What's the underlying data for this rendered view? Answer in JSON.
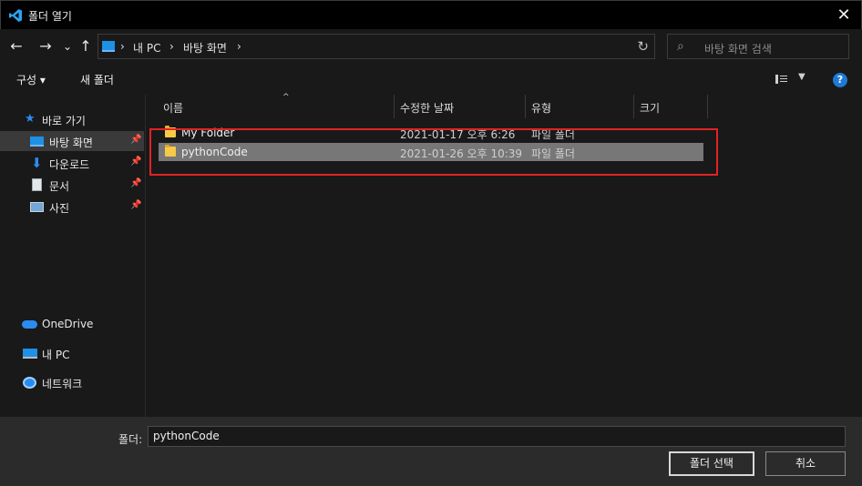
{
  "titlebar": {
    "title": "폴더 열기",
    "app_icon": "vscode-icon",
    "close_label": "✕"
  },
  "navbar": {
    "back_glyph": "←",
    "forward_glyph": "→",
    "recent_glyph": "⌄",
    "up_glyph": "↑",
    "breadcrumb": [
      "내 PC",
      "바탕 화면"
    ],
    "separator": "›",
    "refresh_glyph": "↻",
    "search_placeholder": "바탕 화면 검색"
  },
  "toolbar": {
    "organize": "구성 ▾",
    "new_folder": "새 폴더",
    "help": "?"
  },
  "sidebar": {
    "items": [
      {
        "label": "바로 가기",
        "icon": "star-icon"
      },
      {
        "label": "바탕 화면",
        "icon": "desktop-icon",
        "pinned": true,
        "selected": true
      },
      {
        "label": "다운로드",
        "icon": "download-icon",
        "pinned": true
      },
      {
        "label": "문서",
        "icon": "document-icon",
        "pinned": true
      },
      {
        "label": "사진",
        "icon": "picture-icon",
        "pinned": true
      },
      {
        "label": "OneDrive",
        "icon": "onedrive-icon"
      },
      {
        "label": "내 PC",
        "icon": "computer-icon"
      },
      {
        "label": "네트워크",
        "icon": "network-icon"
      }
    ],
    "pin_glyph": "📌"
  },
  "columns": {
    "name": "이름",
    "modified": "수정한 날짜",
    "type": "유형",
    "size": "크기"
  },
  "files": [
    {
      "name": "My Folder",
      "modified": "2021-01-17 오후 6:26",
      "type": "파일 폴더"
    },
    {
      "name": "pythonCode",
      "modified": "2021-01-26 오후 10:39",
      "type": "파일 폴더",
      "selected": true
    }
  ],
  "footer": {
    "folder_label": "폴더:",
    "folder_value": "pythonCode",
    "select_button": "폴더 선택",
    "cancel_button": "취소"
  },
  "colors": {
    "accent": "#1e7ad6",
    "highlight_box": "#e02424",
    "selected_row": "#777777"
  }
}
